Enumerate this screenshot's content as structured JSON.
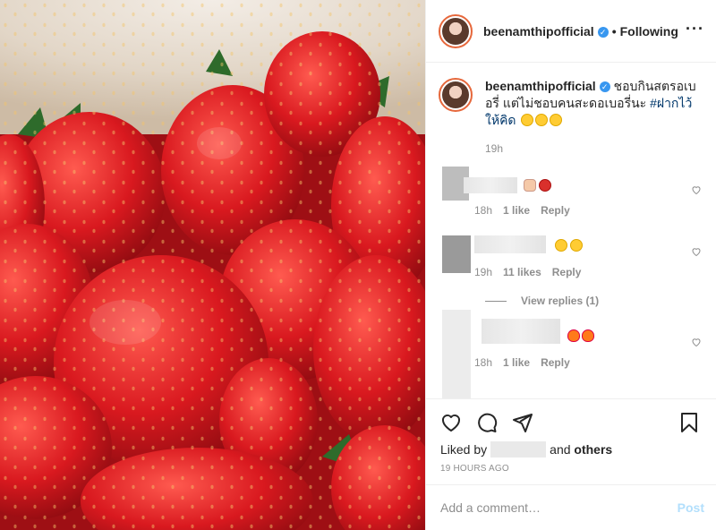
{
  "post": {
    "image_alt": "strawberries",
    "username": "beenamthipofficial",
    "verified": true,
    "follow_state": "Following",
    "separator": "•"
  },
  "caption": {
    "username": "beenamthipofficial",
    "text": "ชอบกินสตรอเบอรี่ แต่ไม่ชอบคนสะดอเบอรี่นะ ",
    "hashtag": "#ฝากไว้ให้คิด",
    "time": "19h"
  },
  "comments": [
    {
      "time": "18h",
      "likes": "1 like",
      "reply": "Reply"
    },
    {
      "time": "19h",
      "likes": "11 likes",
      "reply": "Reply"
    },
    {
      "time": "18h",
      "likes": "1 like",
      "reply": "Reply"
    }
  ],
  "view_replies": "View replies (1)",
  "likes": {
    "prefix": "Liked by",
    "suffix": "and",
    "others": "others"
  },
  "timestamp": "19 HOURS AGO",
  "comment_input": {
    "placeholder": "Add a comment…"
  },
  "post_button": "Post",
  "colors": {
    "link": "#00376b",
    "verified": "#3897f0",
    "post_button": "#b2dffc",
    "muted": "#8e8e8e"
  },
  "icons": [
    "heart-icon",
    "comment-icon",
    "share-icon",
    "bookmark-icon",
    "more-icon",
    "verified-icon"
  ]
}
